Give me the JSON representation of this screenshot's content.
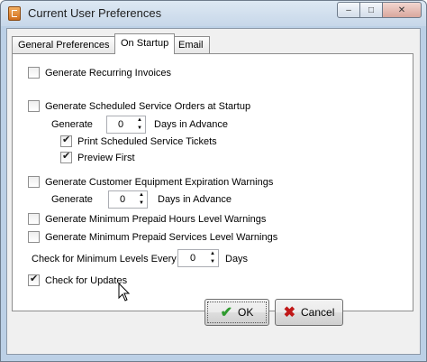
{
  "window": {
    "title": "Current User Preferences",
    "buttons": {
      "minimize": "‒",
      "maximize": "□",
      "close": "✕"
    }
  },
  "tabs": [
    {
      "label": "General Preferences",
      "active": false
    },
    {
      "label": "On Startup",
      "active": true
    },
    {
      "label": "Email",
      "active": false
    }
  ],
  "startup": {
    "recurring_invoices": {
      "label": "Generate Recurring Invoices",
      "checked": false
    },
    "scheduled_service_orders": {
      "label": "Generate Scheduled Service Orders at Startup",
      "checked": false
    },
    "service_generate_label": "Generate",
    "service_days_value": "0",
    "service_days_suffix": "Days in Advance",
    "print_tickets": {
      "label": "Print Scheduled Service Tickets",
      "checked": true
    },
    "preview_first": {
      "label": "Preview First",
      "checked": true
    },
    "equipment_warnings": {
      "label": "Generate Customer Equipment Expiration Warnings",
      "checked": false
    },
    "equipment_generate_label": "Generate",
    "equipment_days_value": "0",
    "equipment_days_suffix": "Days in Advance",
    "prepaid_hours": {
      "label": "Generate Minimum Prepaid Hours Level Warnings",
      "checked": false
    },
    "prepaid_services": {
      "label": "Generate Minimum Prepaid Services Level Warnings",
      "checked": false
    },
    "check_levels_label": "Check for Minimum Levels Every",
    "check_levels_value": "0",
    "check_levels_suffix": "Days",
    "check_updates": {
      "label": "Check for Updates",
      "checked": true
    }
  },
  "footer": {
    "ok_label": "OK",
    "ok_icon": "checkmark-icon",
    "cancel_label": "Cancel",
    "cancel_icon": "x-icon"
  },
  "colors": {
    "ok_icon": "#2f9a2f",
    "cancel_icon": "#c01818",
    "frame": "#bcd0e6"
  }
}
